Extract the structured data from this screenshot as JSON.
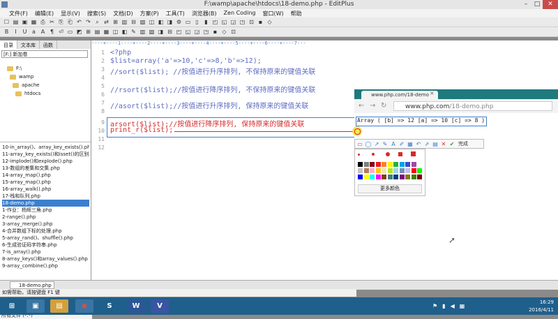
{
  "window": {
    "title": "F:\\wamp\\apache\\htdocs\\18-demo.php - EditPlus",
    "controls": [
      "–",
      "□",
      "✕"
    ]
  },
  "menu": [
    "文件(F)",
    "编辑(E)",
    "显示(V)",
    "搜索(S)",
    "文档(D)",
    "方案(P)",
    "工具(T)",
    "浏览器(B)",
    "Zen Coding",
    "窗口(W)",
    "帮助"
  ],
  "left_panel": {
    "tabs": [
      "目录",
      "文本库",
      "函数"
    ],
    "drive": "[F:] 新加卷",
    "dirs": [
      "F:\\",
      "wamp",
      "apache",
      "htdocs"
    ],
    "files": [
      "10-in_array()、array_key_exists().php",
      "11-array_key_exists()和isset()的区别.php",
      "12-implode()和explode().php",
      "13-数组的差集和交集.php",
      "14-array_map().php",
      "15-array_map().php",
      "16-array_walk().php",
      "17-栈和队列.php",
      "18-demo.php",
      "1-作业：杨辉三角.php",
      "2-range().php",
      "3-array_merge().php",
      "4-合并数组下标的处理.php",
      "5-array_rand()、shuffle().php",
      "6-生成验证码字符串.php",
      "7-is_array().php",
      "8-array_keys()和array_values().php",
      "9-array_combine().php"
    ],
    "selected_file": "18-demo.php",
    "filter": "所有文件 (*.*)"
  },
  "ruler": "----+----1----+----2----+----3----+----4----+----5----+----6----+----7---",
  "editor": {
    "line_numbers": [
      "1",
      "2",
      "3",
      "4",
      "5",
      "6",
      "7",
      "8",
      "9",
      "10",
      "11",
      "12"
    ],
    "lines": [
      "<?php",
      "$list=array('a'=>10,'c'=>8,'b'=>12);",
      "//sort($list); //按值进行升序排列, 不保持原来的键值关联",
      "",
      "//rsort($list);//按值进行降序排列, 不保持原来的键值关联",
      "",
      "//asort($list);//按值进行升序排列, 保持原来的键值关联",
      "",
      "arsort($list);//按值进行降序排列, 保持原来的键值关联",
      "print_r($list);",
      "",
      ""
    ]
  },
  "browser": {
    "tab_title": "www.php.com/18-demo",
    "url_host": "www.php.com",
    "url_path": "/18-demo.php",
    "output": "Array ( [b] => 12 [a] => 10 [c] => 8 )"
  },
  "annotate": {
    "done_label": "完成",
    "more_colors": "更多颜色",
    "colors": [
      "#000000",
      "#7f7f7f",
      "#880015",
      "#ed1c24",
      "#ff7f27",
      "#fff200",
      "#22b14c",
      "#00a2e8",
      "#3f48cc",
      "#a349a4",
      "#ffffff",
      "#c3c3c3",
      "#b97a57",
      "#ffaec9",
      "#ffc90e",
      "#efe4b0",
      "#b5e61d",
      "#99d9ea",
      "#7092be",
      "#c8bfe7",
      "#ff0000",
      "#00ff00",
      "#0000ff",
      "#ffff00",
      "#00ffff",
      "#ff00ff",
      "#804000",
      "#408080",
      "#004080",
      "#800080",
      "#808000",
      "#408000",
      "#800000"
    ]
  },
  "doc_tab": "18-demo.php",
  "status": "如需帮助，请按键盘 F1 键",
  "taskbar": {
    "time": "16:29",
    "date": "2016/4/11",
    "apps": [
      "windows",
      "explorer",
      "files",
      "chrome",
      "sublime",
      "word",
      "visio"
    ]
  }
}
